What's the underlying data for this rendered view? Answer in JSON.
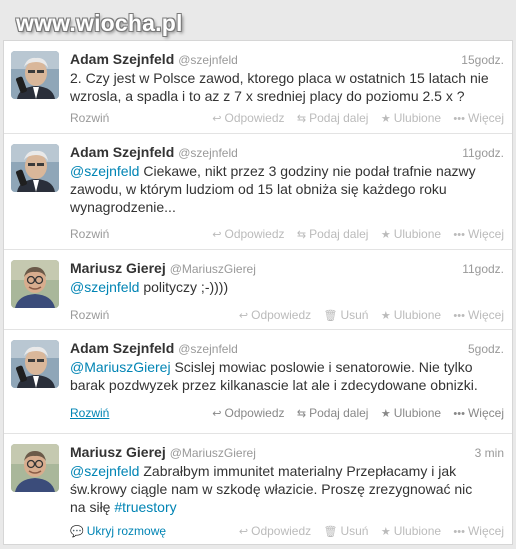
{
  "watermark": "www.wiocha.pl",
  "tweets": [
    {
      "name": "Adam Szejnfeld",
      "handle": "@szejnfeld",
      "time": "15godz.",
      "text": "2. Czy jest w Polsce zawod, ktorego placa w ostatnich 15 latach nie wzrosla, a spadla i to az z 7 x sredniej placy do poziomu 2.5 x ?",
      "expand": "Rozwiń",
      "actions": [
        "Odpowiedz",
        "Podaj dalej",
        "Ulubione",
        "Więcej"
      ]
    },
    {
      "name": "Adam Szejnfeld",
      "handle": "@szejnfeld",
      "time": "11godz.",
      "mention": "@szejnfeld",
      "text": " Ciekawe, nikt przez 3 godziny nie podał trafnie nazwy zawodu, w którym ludziom od 15 lat obniża się każdego roku wynagrodzenie...",
      "expand": "Rozwiń",
      "actions": [
        "Odpowiedz",
        "Podaj dalej",
        "Ulubione",
        "Więcej"
      ]
    },
    {
      "name": "Mariusz Gierej",
      "handle": "@MariuszGierej",
      "time": "11godz.",
      "mention": "@szejnfeld",
      "text": " polityczy ;-))))",
      "expand": "Rozwiń",
      "actions": [
        "Odpowiedz",
        "Usuń",
        "Ulubione",
        "Więcej"
      ]
    },
    {
      "name": "Adam Szejnfeld",
      "handle": "@szejnfeld",
      "time": "5godz.",
      "mention": "@MariuszGierej",
      "text": " Scislej mowiac poslowie i senatorowie. Nie tylko barak pozdwyzek przez kilkanascie lat ale i zdecydowane obnizki.",
      "expand": "Rozwiń",
      "actions": [
        "Odpowiedz",
        "Podaj dalej",
        "Ulubione",
        "Więcej"
      ]
    },
    {
      "name": "Mariusz Gierej",
      "handle": "@MariuszGierej",
      "time": "3 min",
      "mention": "@szejnfeld",
      "text": " Zabrałbym immunitet materialny Przepłacamy i jak św.krowy ciągle nam w szkodę włazicie. Proszę zrezygnować nic na siłę ",
      "hashtag": "#truestory",
      "hide": "Ukryj rozmowę",
      "actions": [
        "Odpowiedz",
        "Usuń",
        "Ulubione",
        "Więcej"
      ]
    }
  ]
}
